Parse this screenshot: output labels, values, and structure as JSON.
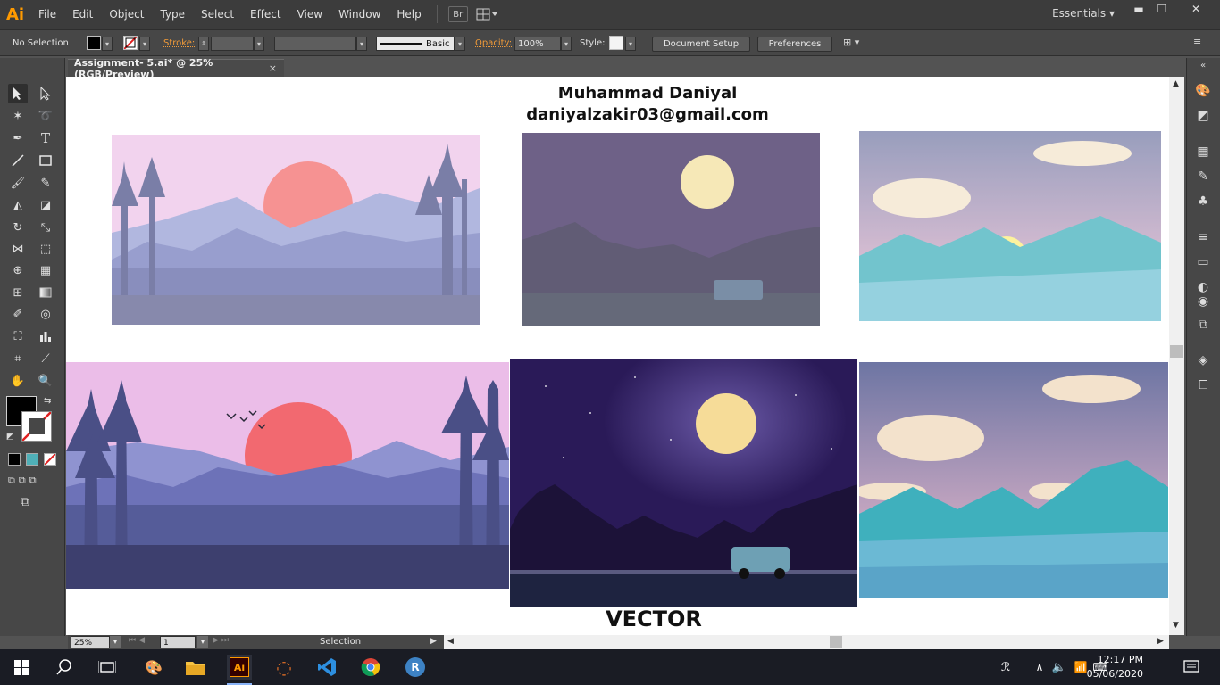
{
  "app": {
    "logo": "Ai",
    "workspace": "Essentials"
  },
  "menu": [
    "File",
    "Edit",
    "Object",
    "Type",
    "Select",
    "Effect",
    "View",
    "Window",
    "Help"
  ],
  "menu_extra": {
    "bridge": "Br"
  },
  "control_bar": {
    "selection": "No Selection",
    "stroke_label": "Stroke:",
    "brush": "Basic",
    "opacity_label": "Opacity:",
    "opacity_value": "100%",
    "style_label": "Style:",
    "document_setup": "Document Setup",
    "preferences": "Preferences"
  },
  "document_tab": {
    "title": "Assignment- 5.ai* @ 25% (RGB/Preview)",
    "close": "×"
  },
  "artboard": {
    "name": "Muhammad Daniyal",
    "email": "daniyalzakir03@gmail.com",
    "caption": "VECTOR"
  },
  "status_bar": {
    "zoom": "25%",
    "page": "1",
    "tool": "Selection"
  },
  "taskbar": {
    "time": "12:17 PM",
    "date": "05/06/2020"
  },
  "icons": {
    "tools": [
      "selection-tool-icon",
      "direct-selection-tool-icon",
      "magic-wand-tool-icon",
      "lasso-tool-icon",
      "pen-tool-icon",
      "type-tool-icon",
      "line-tool-icon",
      "rectangle-tool-icon",
      "paintbrush-tool-icon",
      "pencil-tool-icon",
      "blob-brush-tool-icon",
      "eraser-tool-icon",
      "rotate-tool-icon",
      "scale-tool-icon",
      "width-tool-icon",
      "free-transform-tool-icon",
      "shape-builder-tool-icon",
      "perspective-grid-tool-icon",
      "mesh-tool-icon",
      "gradient-tool-icon",
      "eyedropper-tool-icon",
      "blend-tool-icon",
      "symbol-sprayer-tool-icon",
      "column-graph-tool-icon",
      "artboard-tool-icon",
      "slice-tool-icon",
      "hand-tool-icon",
      "zoom-tool-icon"
    ]
  },
  "colors": {
    "illustrator_orange": "#ff9a00",
    "menubar": "#3c3c3c",
    "panel": "#474747",
    "workspace": "#535353",
    "taskbar": "#1a1c24"
  }
}
